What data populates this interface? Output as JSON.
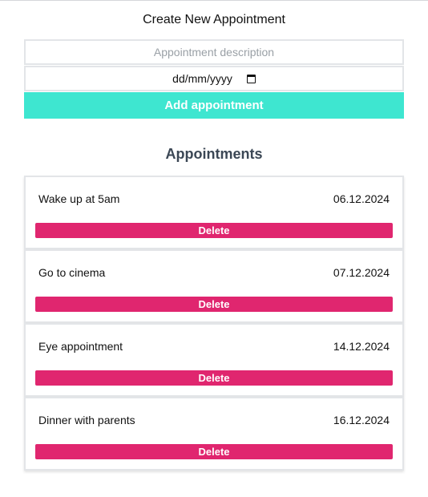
{
  "form": {
    "title": "Create New Appointment",
    "description_placeholder": "Appointment description",
    "date_placeholder": "dd/mm/yyyy",
    "add_button_label": "Add appointment"
  },
  "list": {
    "title": "Appointments",
    "items": [
      {
        "description": "Wake up at 5am",
        "date": "06.12.2024",
        "delete_label": "Delete"
      },
      {
        "description": "Go to cinema",
        "date": "07.12.2024",
        "delete_label": "Delete"
      },
      {
        "description": "Eye appointment",
        "date": "14.12.2024",
        "delete_label": "Delete"
      },
      {
        "description": "Dinner with parents",
        "date": "16.12.2024",
        "delete_label": "Delete"
      }
    ]
  },
  "colors": {
    "add_button": "#3ee6d0",
    "delete_button": "#e0266f",
    "list_title": "#3b4755"
  },
  "icons": {
    "date_picker": "calendar-icon"
  }
}
